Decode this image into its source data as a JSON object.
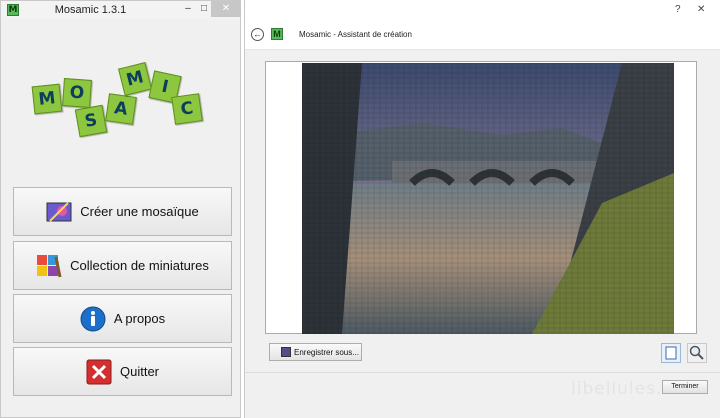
{
  "left_window": {
    "title": "Mosamic 1.3.1",
    "app_icon_letter": "M",
    "controls": {
      "minimize": "–",
      "maximize": "□",
      "close": "✕"
    },
    "logo_letters": [
      "M",
      "O",
      "S",
      "A",
      "M",
      "I",
      "C"
    ],
    "menu": [
      {
        "label": "Créer une mosaïque",
        "icon": "create-mosaic-icon"
      },
      {
        "label": "Collection de miniatures",
        "icon": "thumbnail-collection-icon"
      },
      {
        "label": "A propos",
        "icon": "info-icon"
      },
      {
        "label": "Quitter",
        "icon": "quit-icon"
      }
    ]
  },
  "right_window": {
    "controls": {
      "help": "?",
      "close": "✕"
    },
    "wizard_icon_letter": "M",
    "wizard_title": "Mosamic - Assistant de création",
    "save_label": "Enregistrer sous...",
    "finish_label": "Terminer",
    "watermark": "libellules.ch"
  },
  "colors": {
    "tile_green": "#8dc63f",
    "tile_text": "#0d3d5c",
    "brand_green": "#5cb85c"
  }
}
